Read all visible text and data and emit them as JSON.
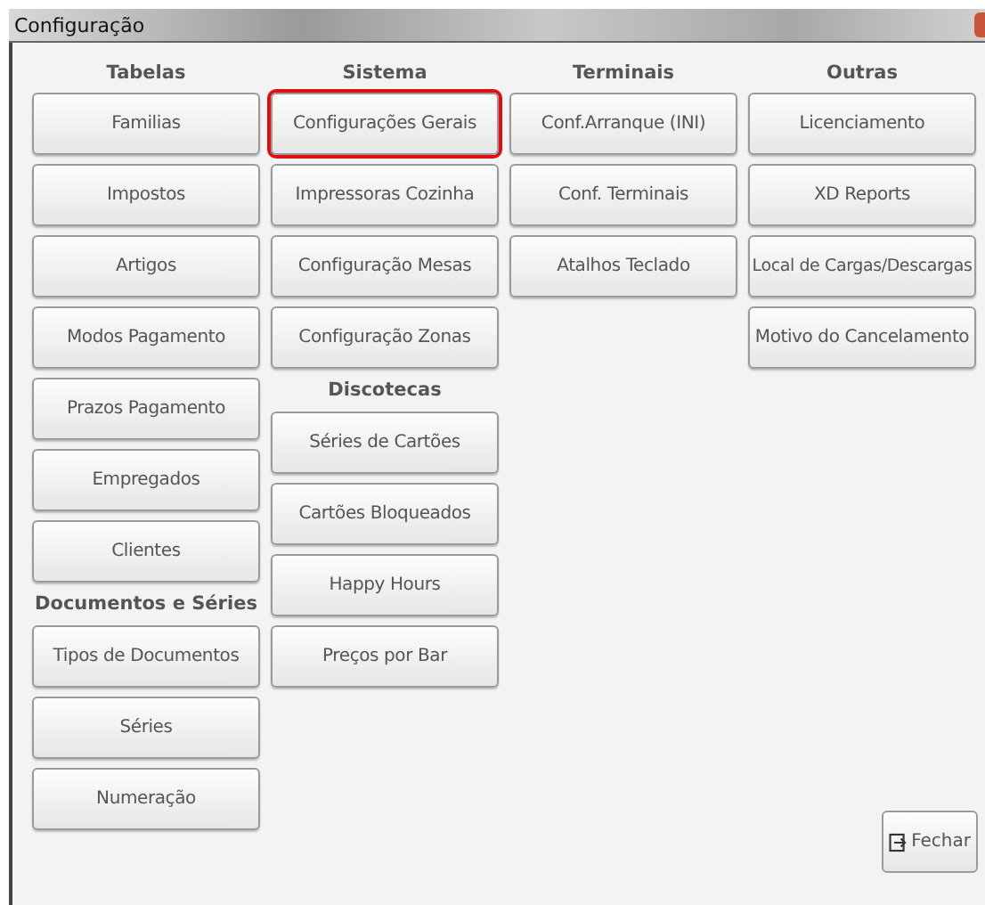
{
  "window": {
    "title": "Configuração"
  },
  "columns": [
    {
      "groups": [
        {
          "heading": "Tabelas",
          "buttons": [
            {
              "label": "Familias",
              "selected": false
            },
            {
              "label": "Impostos",
              "selected": false
            },
            {
              "label": "Artigos",
              "selected": false
            },
            {
              "label": "Modos Pagamento",
              "selected": false
            },
            {
              "label": "Prazos Pagamento",
              "selected": false
            },
            {
              "label": "Empregados",
              "selected": false
            },
            {
              "label": "Clientes",
              "selected": false
            }
          ]
        },
        {
          "heading": "Documentos e Séries",
          "buttons": [
            {
              "label": "Tipos de Documentos",
              "selected": false
            },
            {
              "label": "Séries",
              "selected": false
            },
            {
              "label": "Numeração",
              "selected": false
            }
          ]
        }
      ]
    },
    {
      "groups": [
        {
          "heading": "Sistema",
          "buttons": [
            {
              "label": "Configurações Gerais",
              "selected": true
            },
            {
              "label": "Impressoras Cozinha",
              "selected": false
            },
            {
              "label": "Configuração Mesas",
              "selected": false
            },
            {
              "label": "Configuração Zonas",
              "selected": false
            }
          ]
        },
        {
          "heading": "Discotecas",
          "buttons": [
            {
              "label": "Séries de Cartões",
              "selected": false
            },
            {
              "label": "Cartões Bloqueados",
              "selected": false
            },
            {
              "label": "Happy Hours",
              "selected": false
            },
            {
              "label": "Preços por Bar",
              "selected": false
            }
          ]
        }
      ]
    },
    {
      "groups": [
        {
          "heading": "Terminais",
          "buttons": [
            {
              "label": "Conf.Arranque (INI)",
              "selected": false
            },
            {
              "label": "Conf. Terminais",
              "selected": false
            },
            {
              "label": "Atalhos Teclado",
              "selected": false
            }
          ]
        }
      ]
    },
    {
      "groups": [
        {
          "heading": "Outras",
          "buttons": [
            {
              "label": "Licenciamento",
              "selected": false
            },
            {
              "label": "XD Reports",
              "selected": false
            },
            {
              "label": "Local de Cargas/Descargas",
              "selected": false
            },
            {
              "label": "Motivo do Cancelamento",
              "selected": false
            }
          ]
        }
      ]
    }
  ],
  "close_button": {
    "label": "Fechar"
  }
}
